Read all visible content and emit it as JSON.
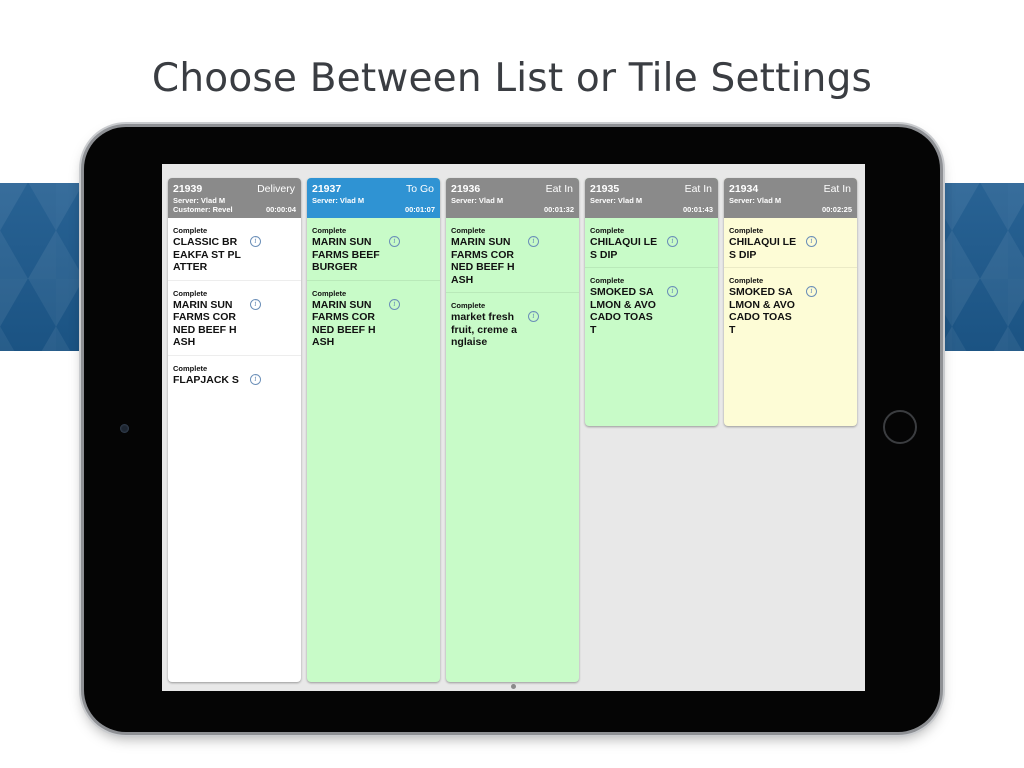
{
  "headline": "Choose Between List or Tile Settings",
  "colors": {
    "header_default": "#8a8a8a",
    "header_active": "#2f93d3",
    "white": "#ffffff",
    "green": "#c8fbc8",
    "yellow": "#fdfcd6",
    "band": "#1d5a8e"
  },
  "tickets": [
    {
      "number": "21939",
      "type": "Delivery",
      "server": "Server: Vlad M",
      "customer": "Customer: Revel",
      "timer": "00:00:04",
      "items": [
        {
          "status": "Complete",
          "name": "CLASSIC BREAKFA ST PLATTER"
        },
        {
          "status": "Complete",
          "name": "MARIN SUN FARMS CORNED BEEF HASH"
        },
        {
          "status": "Complete",
          "name": "FLAPJACK S"
        }
      ]
    },
    {
      "number": "21937",
      "type": "To Go",
      "server": "Server: Vlad M",
      "timer": "00:01:07",
      "items": [
        {
          "status": "Complete",
          "name": "MARIN SUN FARMS BEEF BURGER"
        },
        {
          "status": "Complete",
          "name": "MARIN SUN FARMS CORNED BEEF HASH"
        }
      ]
    },
    {
      "number": "21936",
      "type": "Eat In",
      "server": "Server: Vlad M",
      "timer": "00:01:32",
      "items": [
        {
          "status": "Complete",
          "name": "MARIN SUN FARMS CORNED BEEF HASH"
        },
        {
          "status": "Complete",
          "name": "market fresh fruit, creme anglaise"
        }
      ]
    },
    {
      "number": "21935",
      "type": "Eat In",
      "server": "Server: Vlad M",
      "timer": "00:01:43",
      "items": [
        {
          "status": "Complete",
          "name": "CHILAQUI LES DIP"
        },
        {
          "status": "Complete",
          "name": "SMOKED SALMON & AVOCADO TOAST"
        }
      ]
    },
    {
      "number": "21934",
      "type": "Eat In",
      "server": "Server: Vlad M",
      "timer": "00:02:25",
      "items": [
        {
          "status": "Complete",
          "name": "CHILAQUI LES DIP"
        },
        {
          "status": "Complete",
          "name": "SMOKED SALMON & AVOCADO TOAST"
        }
      ]
    }
  ]
}
